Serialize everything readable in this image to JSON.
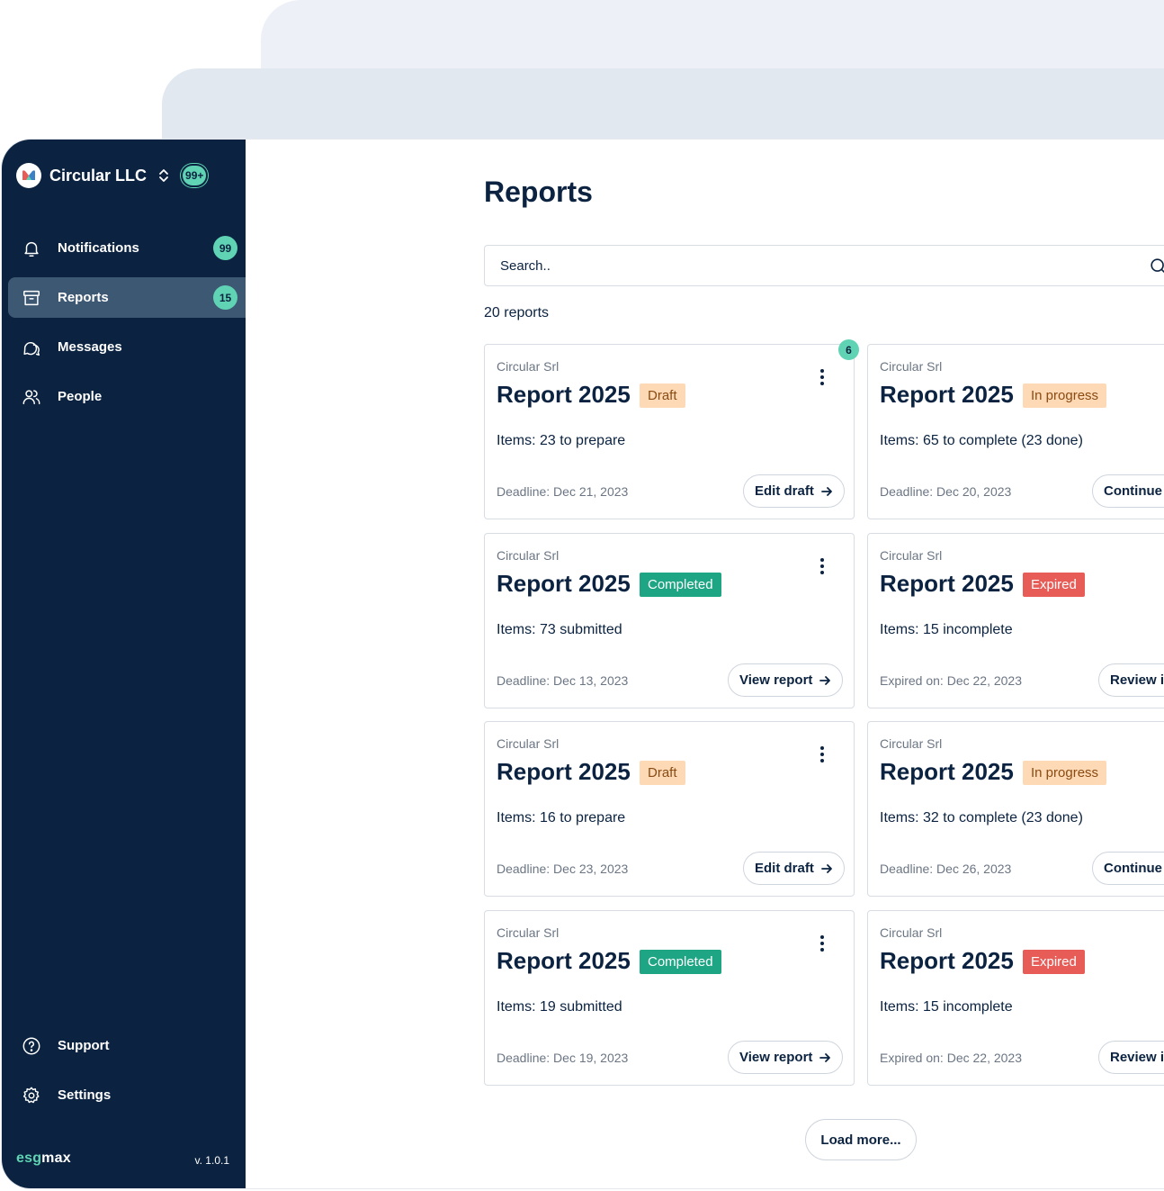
{
  "sidebar": {
    "org_name": "Circular LLC",
    "org_badge": "99+",
    "items": [
      {
        "label": "Notifications",
        "badge": "99",
        "icon": "bell-icon",
        "active": false
      },
      {
        "label": "Reports",
        "badge": "15",
        "icon": "archive-box-icon",
        "active": true
      },
      {
        "label": "Messages",
        "badge": "",
        "icon": "chat-bubbles-icon",
        "active": false
      },
      {
        "label": "People",
        "badge": "",
        "icon": "users-icon",
        "active": false
      }
    ],
    "bottom_items": [
      {
        "label": "Support",
        "icon": "question-circle-icon"
      },
      {
        "label": "Settings",
        "icon": "gear-icon"
      }
    ],
    "brand_prefix": "esg",
    "brand_suffix": "max",
    "version": "v. 1.0.1"
  },
  "main": {
    "title": "Reports",
    "search_placeholder": "Search..",
    "count_label": "20 reports",
    "load_more": "Load more...",
    "cards": [
      {
        "org": "Circular Srl",
        "title": "Report 2025",
        "status": "Draft",
        "status_type": "draft",
        "items": "Items: 23 to prepare",
        "deadline": "Deadline: Dec 21, 2023",
        "action": "Edit draft",
        "corner_badge": "6"
      },
      {
        "org": "Circular Srl",
        "title": "Report 2025",
        "status": "In progress",
        "status_type": "progress",
        "items": "Items: 65 to complete (23 done)",
        "deadline": "Deadline: Dec 20, 2023",
        "action": "Continue",
        "corner_badge": ""
      },
      {
        "org": "Circular Srl",
        "title": "Report 2025",
        "status": "Completed",
        "status_type": "completed",
        "items": "Items: 73 submitted",
        "deadline": "Deadline: Dec 13, 2023",
        "action": "View report",
        "corner_badge": ""
      },
      {
        "org": "Circular Srl",
        "title": "Report 2025",
        "status": "Expired",
        "status_type": "expired",
        "items": "Items: 15 incomplete",
        "deadline": "Expired on: Dec 22, 2023",
        "action": "Review is",
        "corner_badge": ""
      },
      {
        "org": "Circular Srl",
        "title": "Report 2025",
        "status": "Draft",
        "status_type": "draft",
        "items": "Items: 16 to prepare",
        "deadline": "Deadline: Dec 23, 2023",
        "action": "Edit draft",
        "corner_badge": ""
      },
      {
        "org": "Circular Srl",
        "title": "Report 2025",
        "status": "In progress",
        "status_type": "progress",
        "items": "Items: 32 to complete (23 done)",
        "deadline": "Deadline: Dec 26, 2023",
        "action": "Continue",
        "corner_badge": ""
      },
      {
        "org": "Circular Srl",
        "title": "Report 2025",
        "status": "Completed",
        "status_type": "completed",
        "items": "Items: 19 submitted",
        "deadline": "Deadline: Dec 19, 2023",
        "action": "View report",
        "corner_badge": ""
      },
      {
        "org": "Circular Srl",
        "title": "Report 2025",
        "status": "Expired",
        "status_type": "expired",
        "items": "Items: 15 incomplete",
        "deadline": "Expired on: Dec 22, 2023",
        "action": "Review is",
        "corner_badge": ""
      }
    ]
  },
  "colors": {
    "sidebar_bg": "#0b2340",
    "accent_mint": "#5fd3b3",
    "draft_bg": "#fdd9b6",
    "completed_bg": "#1ea583",
    "expired_bg": "#e85c57"
  }
}
